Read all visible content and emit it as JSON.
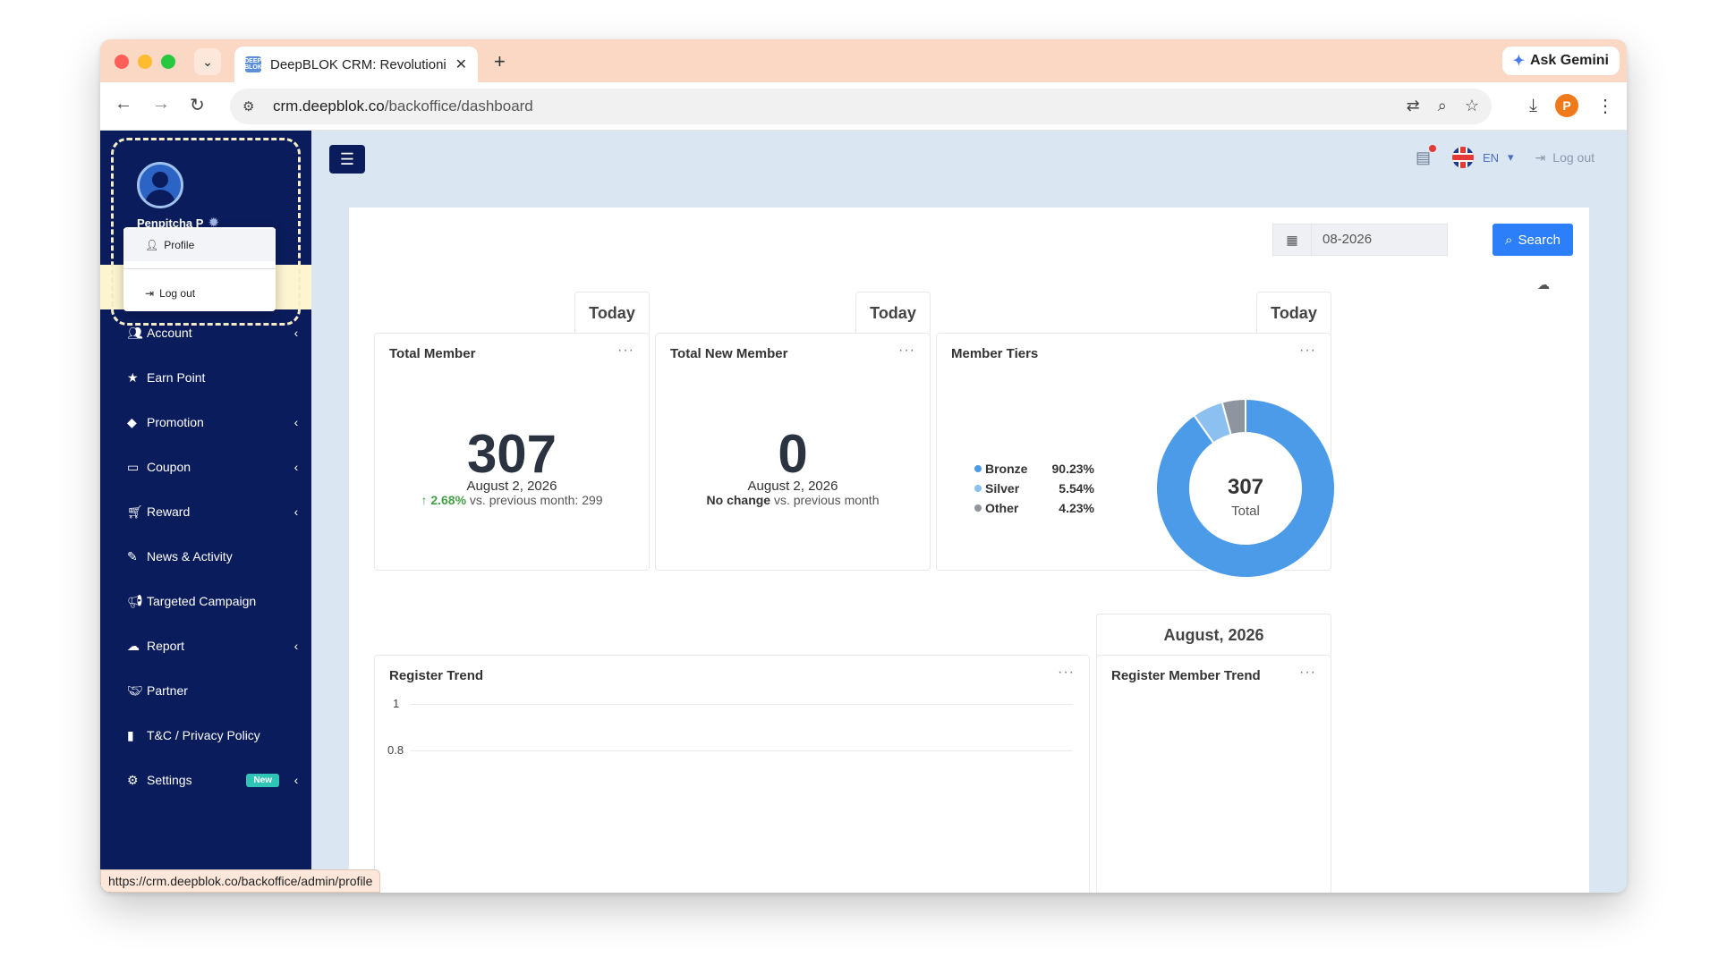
{
  "browser": {
    "tab_title": "DeepBLOK CRM: Revolutioniz",
    "tab_favicon_text": "DEEP BLOK",
    "new_tab": "+",
    "gemini_label": "Ask Gemini",
    "url_domain": "crm.deepblok.co",
    "url_path": "/backoffice/dashboard",
    "profile_initial": "P",
    "status_url": "https://crm.deepblok.co/backoffice/admin/profile"
  },
  "sidebar": {
    "user_name": "Penpitcha P",
    "user_menu": {
      "profile": "Profile",
      "logout": "Log out"
    },
    "items": [
      {
        "label": "Account",
        "icon": "users-icon",
        "chevron": "‹"
      },
      {
        "label": "Earn Point",
        "icon": "star-icon",
        "chevron": ""
      },
      {
        "label": "Promotion",
        "icon": "tag-icon",
        "chevron": "‹"
      },
      {
        "label": "Coupon",
        "icon": "ticket-icon",
        "chevron": "‹"
      },
      {
        "label": "Reward",
        "icon": "cart-icon",
        "chevron": "‹"
      },
      {
        "label": "News & Activity",
        "icon": "edit-icon",
        "chevron": ""
      },
      {
        "label": "Targeted Campaign",
        "icon": "megaphone-icon",
        "chevron": ""
      },
      {
        "label": "Report",
        "icon": "cloud-download-icon",
        "chevron": "‹"
      },
      {
        "label": "Partner",
        "icon": "handshake-icon",
        "chevron": ""
      },
      {
        "label": "T&C / Privacy Policy",
        "icon": "document-icon",
        "chevron": ""
      },
      {
        "label": "Settings",
        "icon": "gear-icon",
        "chevron": "‹",
        "badge": "New"
      }
    ]
  },
  "topbar": {
    "lang": "EN",
    "logout": "Log out"
  },
  "filter": {
    "date_value": "08-2026",
    "search_label": "Search"
  },
  "period_tabs": [
    "Today",
    "Today",
    "Today"
  ],
  "total_member": {
    "title": "Total Member",
    "value": "307",
    "date": "August 2, 2026",
    "change": "2.68%",
    "compare": "vs. previous month: 299"
  },
  "total_new_member": {
    "title": "Total New Member",
    "value": "0",
    "date": "August 2, 2026",
    "change": "No change",
    "compare": "vs. previous month"
  },
  "member_tiers": {
    "title": "Member Tiers",
    "total_value": "307",
    "total_label": "Total",
    "tiers": [
      {
        "name": "Bronze",
        "pct": "90.23%",
        "value": 90.23,
        "color": "#4c9be8"
      },
      {
        "name": "Silver",
        "pct": "5.54%",
        "value": 5.54,
        "color": "#8cc0f0"
      },
      {
        "name": "Other",
        "pct": "4.23%",
        "value": 4.23,
        "color": "#8e959e"
      }
    ]
  },
  "month_tab": "August, 2026",
  "register_trend": {
    "title": "Register Trend",
    "ticks": [
      "1",
      "0.8"
    ]
  },
  "register_member_trend": {
    "title": "Register Member Trend"
  },
  "colors": {
    "sidebar": "#0b1c5c",
    "accent": "#2d7ff9",
    "page_bg": "#dbe6f3"
  }
}
